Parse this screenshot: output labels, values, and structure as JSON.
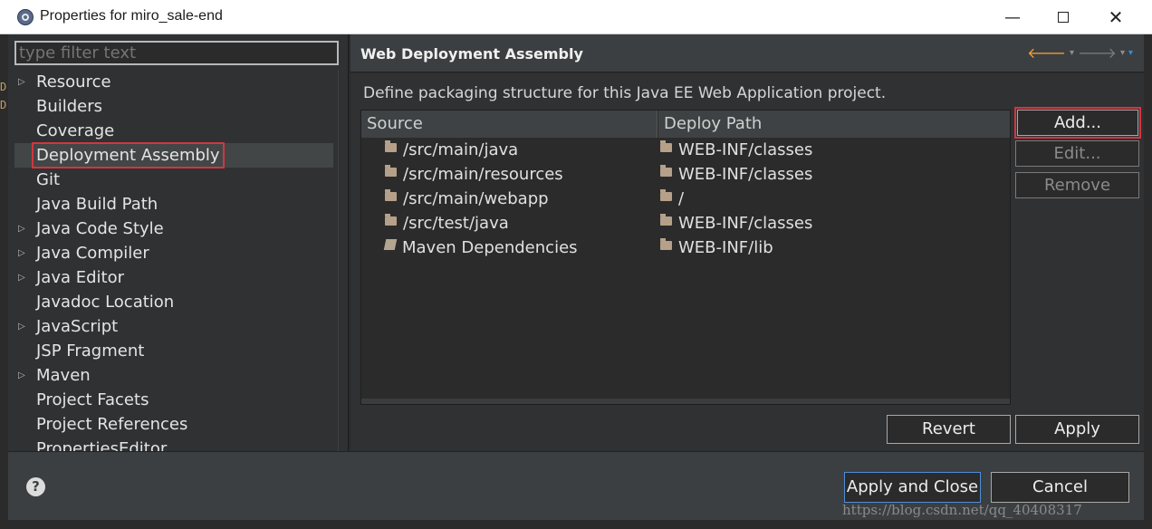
{
  "window": {
    "title": "Properties for miro_sale-end",
    "minimize": "—",
    "close": "✕"
  },
  "filter": {
    "placeholder": "type filter text"
  },
  "left_edge": [
    "D",
    "D"
  ],
  "tree": [
    {
      "label": "Resource",
      "expandable": true
    },
    {
      "label": "Builders",
      "expandable": false
    },
    {
      "label": "Coverage",
      "expandable": false
    },
    {
      "label": "Deployment Assembly",
      "expandable": false,
      "selected": true
    },
    {
      "label": "Git",
      "expandable": false
    },
    {
      "label": "Java Build Path",
      "expandable": false
    },
    {
      "label": "Java Code Style",
      "expandable": true
    },
    {
      "label": "Java Compiler",
      "expandable": true
    },
    {
      "label": "Java Editor",
      "expandable": true
    },
    {
      "label": "Javadoc Location",
      "expandable": false
    },
    {
      "label": "JavaScript",
      "expandable": true
    },
    {
      "label": "JSP Fragment",
      "expandable": false
    },
    {
      "label": "Maven",
      "expandable": true
    },
    {
      "label": "Project Facets",
      "expandable": false
    },
    {
      "label": "Project References",
      "expandable": false
    },
    {
      "label": "PropertiesEditor",
      "expandable": false
    }
  ],
  "page": {
    "title": "Web Deployment Assembly",
    "description": "Define packaging structure for this Java EE Web Application project.",
    "nav": {
      "back": "🡐",
      "forward": "🡒",
      "dropdown": "▾",
      "menu": "▾"
    }
  },
  "table": {
    "headers": {
      "source": "Source",
      "deploy_path": "Deploy Path"
    },
    "rows": [
      {
        "source": "/src/main/java",
        "deploy": "WEB-INF/classes",
        "icon": "folder-icon"
      },
      {
        "source": "/src/main/resources",
        "deploy": "WEB-INF/classes",
        "icon": "folder-icon"
      },
      {
        "source": "/src/main/webapp",
        "deploy": "/",
        "icon": "folder-icon"
      },
      {
        "source": "/src/test/java",
        "deploy": "WEB-INF/classes",
        "icon": "folder-icon"
      },
      {
        "source": "Maven Dependencies",
        "deploy": "WEB-INF/lib",
        "icon": "library-icon"
      }
    ]
  },
  "buttons": {
    "add": "Add...",
    "edit": "Edit...",
    "remove": "Remove",
    "revert": "Revert",
    "apply": "Apply",
    "apply_and_close": "Apply and Close",
    "cancel": "Cancel",
    "help": "?"
  },
  "watermark": "https://blog.csdn.net/qq_40408317",
  "colors": {
    "accent_red": "#d3363e",
    "back_arrow": "#f3a43a",
    "menu_arrow": "#2f8fd8",
    "default_button_border": "#4e8ed6"
  }
}
